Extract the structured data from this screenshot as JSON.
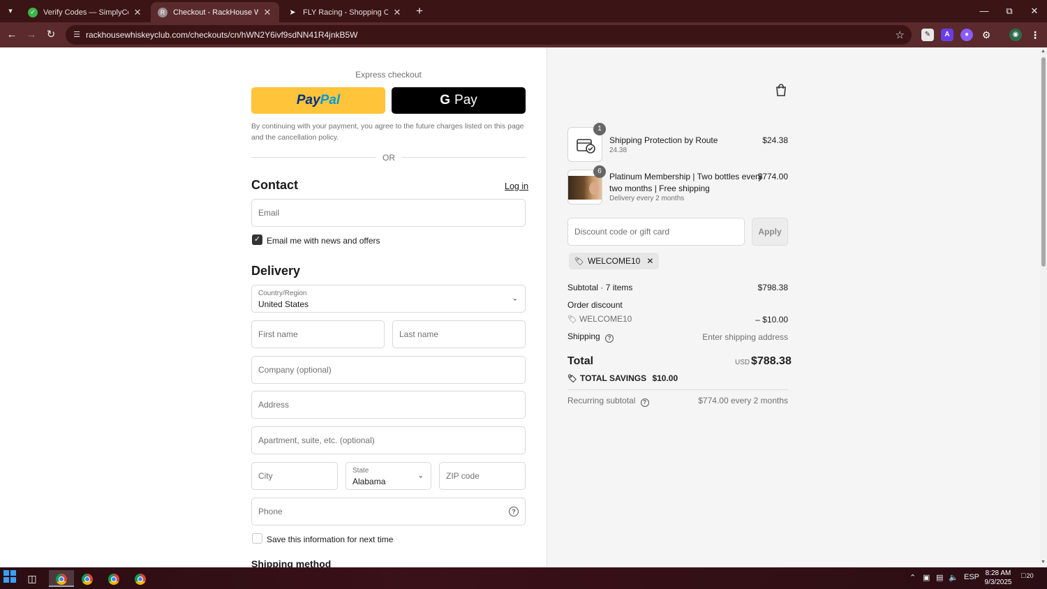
{
  "browser": {
    "tabs": [
      {
        "title": "Verify Codes — SimplyCodes",
        "active": false
      },
      {
        "title": "Checkout - RackHouse Whiskey",
        "active": true
      },
      {
        "title": "FLY Racing - Shopping Cart",
        "active": false
      }
    ],
    "url": "rackhousewhiskeyclub.com/checkouts/cn/hWN2Y6ivf9sdNN41R4jnkB5W",
    "accent": "#5a2a2c"
  },
  "checkout": {
    "express_label": "Express checkout",
    "paypal": {
      "part1": "Pay",
      "part2": "Pal"
    },
    "gpay_label": "Pay",
    "consent_text": "By continuing with your payment, you agree to the future charges listed on this page and the cancellation policy.",
    "or_text": "OR",
    "contact": {
      "heading": "Contact",
      "login_label": "Log in",
      "email_placeholder": "Email",
      "newsletter_label": "Email me with news and offers",
      "newsletter_checked": true
    },
    "delivery": {
      "heading": "Delivery",
      "country_label": "Country/Region",
      "country_value": "United States",
      "first_name": "First name",
      "last_name": "Last name",
      "company": "Company (optional)",
      "address": "Address",
      "apartment": "Apartment, suite, etc. (optional)",
      "city": "City",
      "state_label": "State",
      "state_value": "Alabama",
      "zip": "ZIP code",
      "phone": "Phone",
      "save_info_label": "Save this information for next time",
      "save_info_checked": false
    },
    "shipping_method_heading": "Shipping method"
  },
  "summary": {
    "items": [
      {
        "qty": "1",
        "name_line1": "Shipping Protection by Route",
        "name_line2": "",
        "sub": "24.38",
        "price": "$24.38",
        "icon": "shipping-protection-icon"
      },
      {
        "qty": "6",
        "name_line1": "Platinum Membership | Two bottles every",
        "name_line2": "two months | Free shipping",
        "sub": "Delivery every 2 months",
        "price": "$774.00",
        "icon": "membership-product-image"
      }
    ],
    "discount_placeholder": "Discount code or gift card",
    "apply_label": "Apply",
    "applied_code": "WELCOME10",
    "subtotal_label": "Subtotal · 7 items",
    "subtotal_value": "$798.38",
    "order_discount_label": "Order discount",
    "discount_code": "WELCOME10",
    "discount_value": "– $10.00",
    "shipping_label": "Shipping",
    "shipping_value": "Enter shipping address",
    "total_label": "Total",
    "total_currency": "USD",
    "total_value": "$788.38",
    "savings_label": "TOTAL SAVINGS",
    "savings_value": "$10.00",
    "recurring_label": "Recurring subtotal",
    "recurring_value": "$774.00 every 2 months"
  },
  "taskbar": {
    "language": "ESP",
    "time": "8:28 AM",
    "date": "9/3/2025",
    "notifications": "20"
  }
}
